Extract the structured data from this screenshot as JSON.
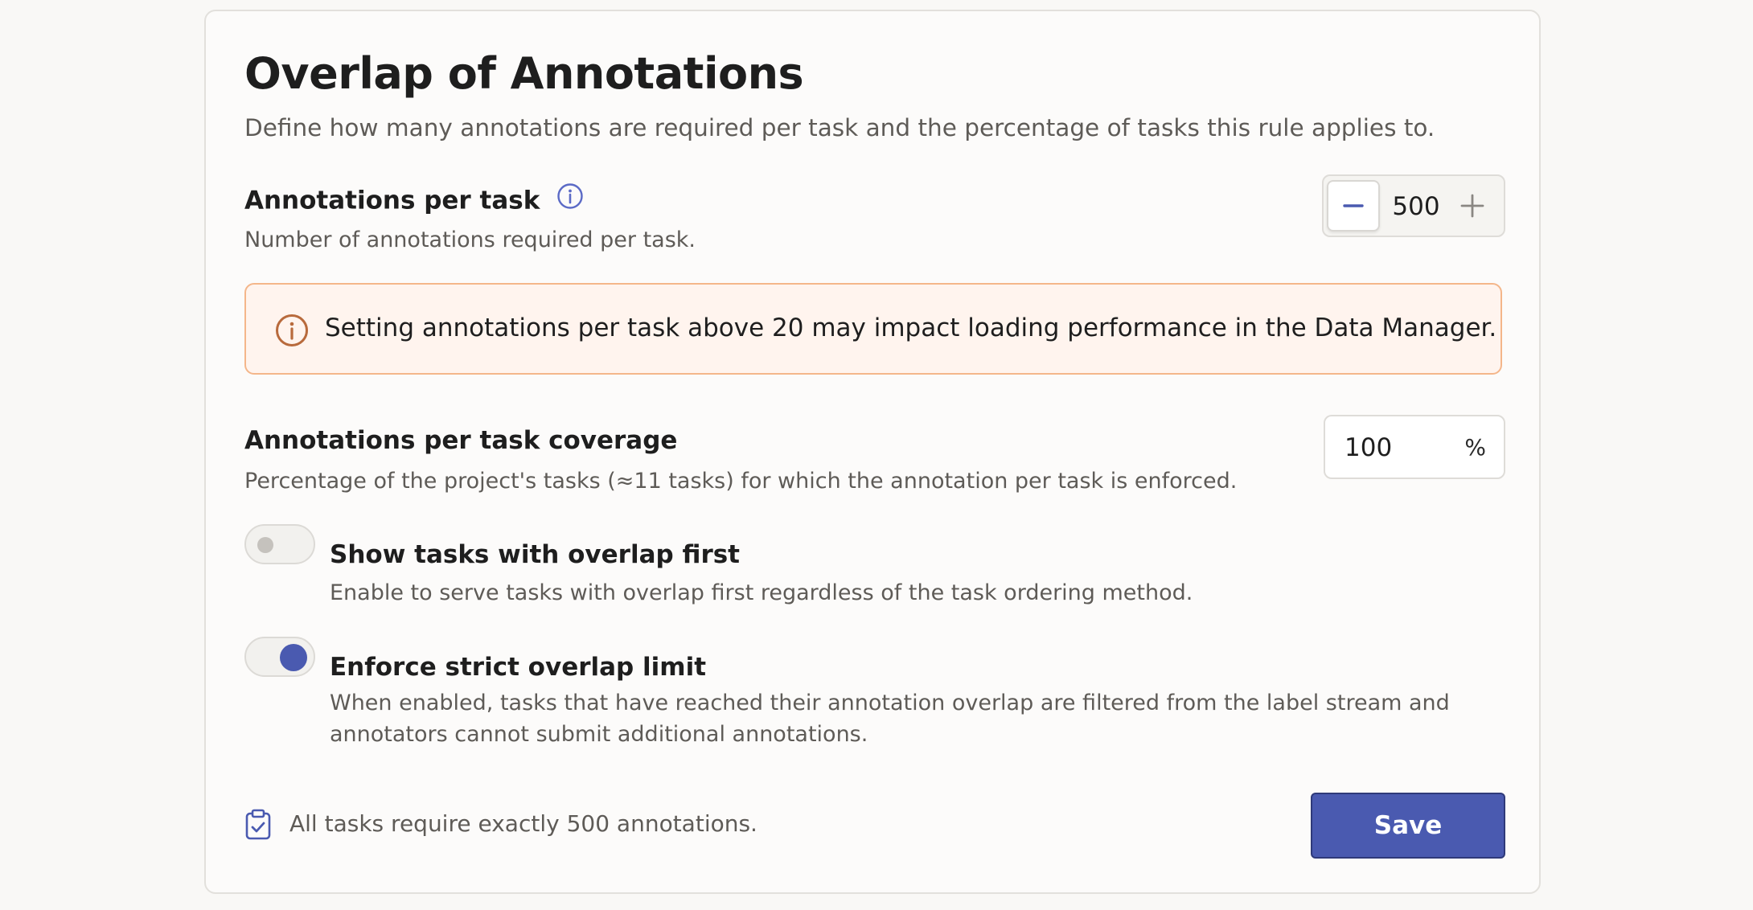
{
  "card": {
    "title": "Overlap of Annotations",
    "subtitle": "Define how many annotations are required per task and the percentage of tasks this rule applies to."
  },
  "annotations_per_task": {
    "label": "Annotations per task",
    "info_icon": "info-circle-icon",
    "description": "Number of annotations required per task.",
    "value": "500",
    "decrement_icon": "minus-icon",
    "increment_icon": "plus-icon"
  },
  "warning": {
    "icon": "info-circle-icon",
    "text": "Setting annotations per task above 20 may impact loading performance in the Data Manager."
  },
  "coverage": {
    "label": "Annotations per task coverage",
    "description": "Percentage of the project's tasks (≈11 tasks) for which the annotation per task is enforced.",
    "value": "100",
    "suffix": "%"
  },
  "show_overlap_first": {
    "label": "Show tasks with overlap first",
    "description": "Enable to serve tasks with overlap first regardless of the task ordering method.",
    "enabled": false
  },
  "strict_limit": {
    "label": "Enforce strict overlap limit",
    "description": "When enabled, tasks that have reached their annotation overlap are filtered from the label stream and annotators cannot submit additional annotations.",
    "enabled": true
  },
  "footer": {
    "icon": "clipboard-check-icon",
    "summary": "All tasks require exactly 500 annotations.",
    "save_label": "Save"
  },
  "colors": {
    "accent": "#4a5ab0",
    "warning_border": "#f4b68a",
    "warning_bg": "#fff4ee",
    "warning_icon": "#b86a3c"
  }
}
